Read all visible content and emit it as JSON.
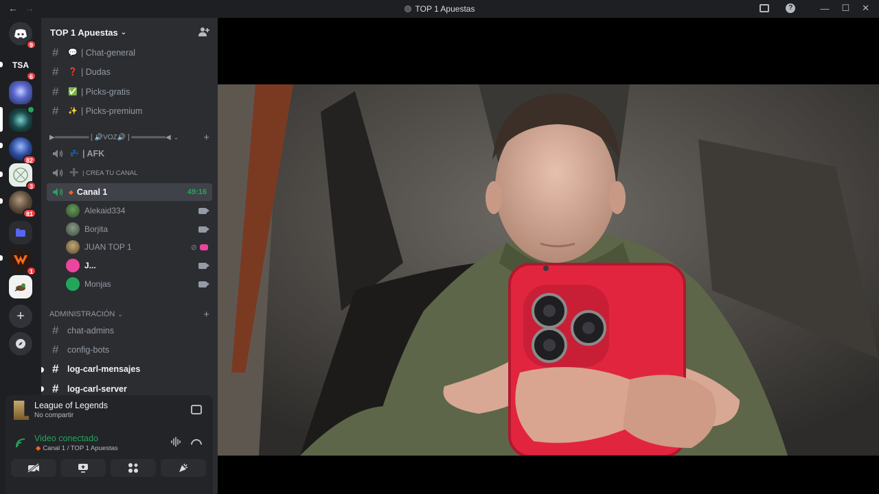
{
  "window": {
    "title": "TOP 1 Apuestas",
    "back_glyph": "←",
    "forward_glyph": "→",
    "minimize_glyph": "—",
    "maximize_glyph": "☐",
    "close_glyph": "✕",
    "help_glyph": "?"
  },
  "guilds": [
    {
      "label": "",
      "icon": "discord-home-icon",
      "badge": "9",
      "color": "#313338"
    },
    {
      "label": "TSA",
      "icon": "server-tsa",
      "badge": "6",
      "color": "#1e1f22"
    },
    {
      "label": "",
      "icon": "server-avatar-blue",
      "badge": "",
      "color": "#3a4a8a"
    },
    {
      "label": "",
      "icon": "server-avatar-green",
      "badge": "",
      "color": "#1f3a2f"
    },
    {
      "label": "",
      "icon": "server-avatar-blue-logo",
      "badge": "82",
      "color": "#1d2f5a"
    },
    {
      "label": "",
      "icon": "server-avatar-white",
      "badge": "3",
      "color": "#e8ecea"
    },
    {
      "label": "",
      "icon": "server-avatar-dark",
      "badge": "81",
      "color": "#3a3330"
    },
    {
      "label": "",
      "icon": "folder-icon",
      "badge": "",
      "color": "#2b2d31"
    },
    {
      "label": "",
      "icon": "server-avatar-orange",
      "badge": "1",
      "color": "#2a1a14"
    },
    {
      "label": "",
      "icon": "server-avatar-bird",
      "badge": "",
      "color": "#f2f2f2"
    }
  ],
  "guild_actions": {
    "add": "+",
    "explore": "⌖"
  },
  "server": {
    "name": "TOP 1 Apuestas"
  },
  "channels_top": [
    {
      "emoji": "💬",
      "name": "| Chat-general"
    },
    {
      "emoji": "❓",
      "name": "| Dudas"
    },
    {
      "emoji": "✅",
      "name": "| Picks-gratis"
    },
    {
      "emoji": "✨",
      "name": "| Picks-premium"
    }
  ],
  "voice_category": {
    "label": "▶═══════ [ 🔊VOZ🔊 ] ═══════◀"
  },
  "voice_channels": [
    {
      "emoji": "💤",
      "name": "| AFK",
      "small": false
    },
    {
      "emoji": "➕",
      "name": "| CREA TU CANAL",
      "small": true
    }
  ],
  "active_voice": {
    "name": "Canal 1",
    "timer": "49:16"
  },
  "voice_users": [
    {
      "name": "Alekaid334",
      "color": "#3c6e3a",
      "muted": false
    },
    {
      "name": "Borjita",
      "color": "#5b6b5a",
      "muted": false
    },
    {
      "name": "JUAN TOP 1",
      "color": "#8a7a5a",
      "muted": true
    },
    {
      "name": "J...",
      "color": "#eb459e",
      "muted": false,
      "bold": true
    },
    {
      "name": "Monjas",
      "color": "#23a55a",
      "muted": false
    }
  ],
  "admin_category": {
    "label": "ADMINISTRACIÓN"
  },
  "admin_channels": [
    {
      "name": "chat-admins",
      "unread": false
    },
    {
      "name": "config-bots",
      "unread": false
    },
    {
      "name": "log-carl-mensajes",
      "unread": true
    },
    {
      "name": "log-carl-server",
      "unread": true
    }
  ],
  "activity": {
    "game": "League of Legends",
    "status": "No compartir"
  },
  "voice_status": {
    "title": "Video conectado",
    "channel": "Canal 1 / TOP 1 Apuestas"
  },
  "voice_buttons": [
    {
      "name": "camera-off-button"
    },
    {
      "name": "share-screen-button"
    },
    {
      "name": "activities-button"
    },
    {
      "name": "soundboard-button"
    }
  ]
}
